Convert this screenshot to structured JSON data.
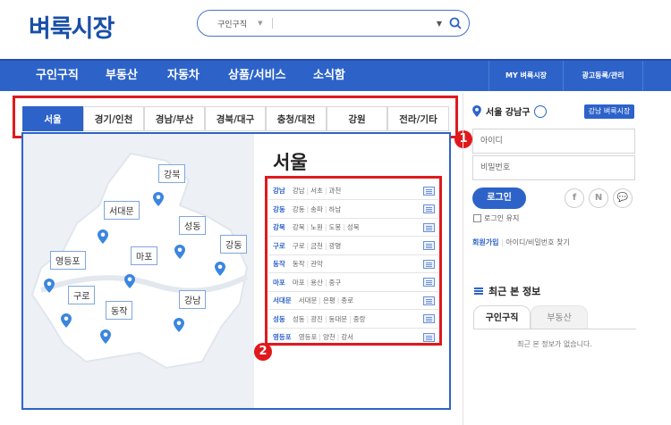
{
  "logo": "벼룩시장",
  "search": {
    "category": "구인구직",
    "value": ""
  },
  "nav": {
    "items": [
      "구인구직",
      "부동산",
      "자동차",
      "상품/서비스",
      "소식함"
    ],
    "my": "MY 벼룩시장",
    "ad": "광고등록/관리"
  },
  "tabs": [
    "서울",
    "경기/인천",
    "경남/부산",
    "경북/대구",
    "충청/대전",
    "강원",
    "전라/기타"
  ],
  "markers": [
    "1",
    "2"
  ],
  "region_title": "서울",
  "districts": [
    {
      "name": "강남",
      "subs": [
        "강남",
        "서초",
        "과천"
      ]
    },
    {
      "name": "강동",
      "subs": [
        "강동",
        "송파",
        "하남"
      ]
    },
    {
      "name": "강북",
      "subs": [
        "강북",
        "노원",
        "도봉",
        "성북"
      ]
    },
    {
      "name": "구로",
      "subs": [
        "구로",
        "금천",
        "광명"
      ]
    },
    {
      "name": "동작",
      "subs": [
        "동작",
        "관악"
      ]
    },
    {
      "name": "마포",
      "subs": [
        "마포",
        "용산",
        "중구"
      ]
    },
    {
      "name": "서대문",
      "subs": [
        "서대문",
        "은평",
        "종로"
      ]
    },
    {
      "name": "성동",
      "subs": [
        "성동",
        "광진",
        "동대문",
        "중랑"
      ]
    },
    {
      "name": "영등포",
      "subs": [
        "영등포",
        "양천",
        "강서"
      ]
    }
  ],
  "map_labels": [
    "강북",
    "서대문",
    "성동",
    "강동",
    "마포",
    "영등포",
    "구로",
    "강남",
    "동작"
  ],
  "login": {
    "location": "서울 강남구",
    "local_button": "강남 벼룩시장",
    "id_placeholder": "아이디",
    "pw_placeholder": "비밀번호",
    "login_button": "로그인",
    "social": [
      "f",
      "N",
      "💬"
    ],
    "keep_login": "로그인 유지",
    "join": "회원가입",
    "find": "아이디/비밀번호 찾기"
  },
  "recent": {
    "title": "최근 본 정보",
    "tabs": [
      "구인구직",
      "부동산"
    ],
    "empty": "최근 본 정보가 없습니다."
  }
}
